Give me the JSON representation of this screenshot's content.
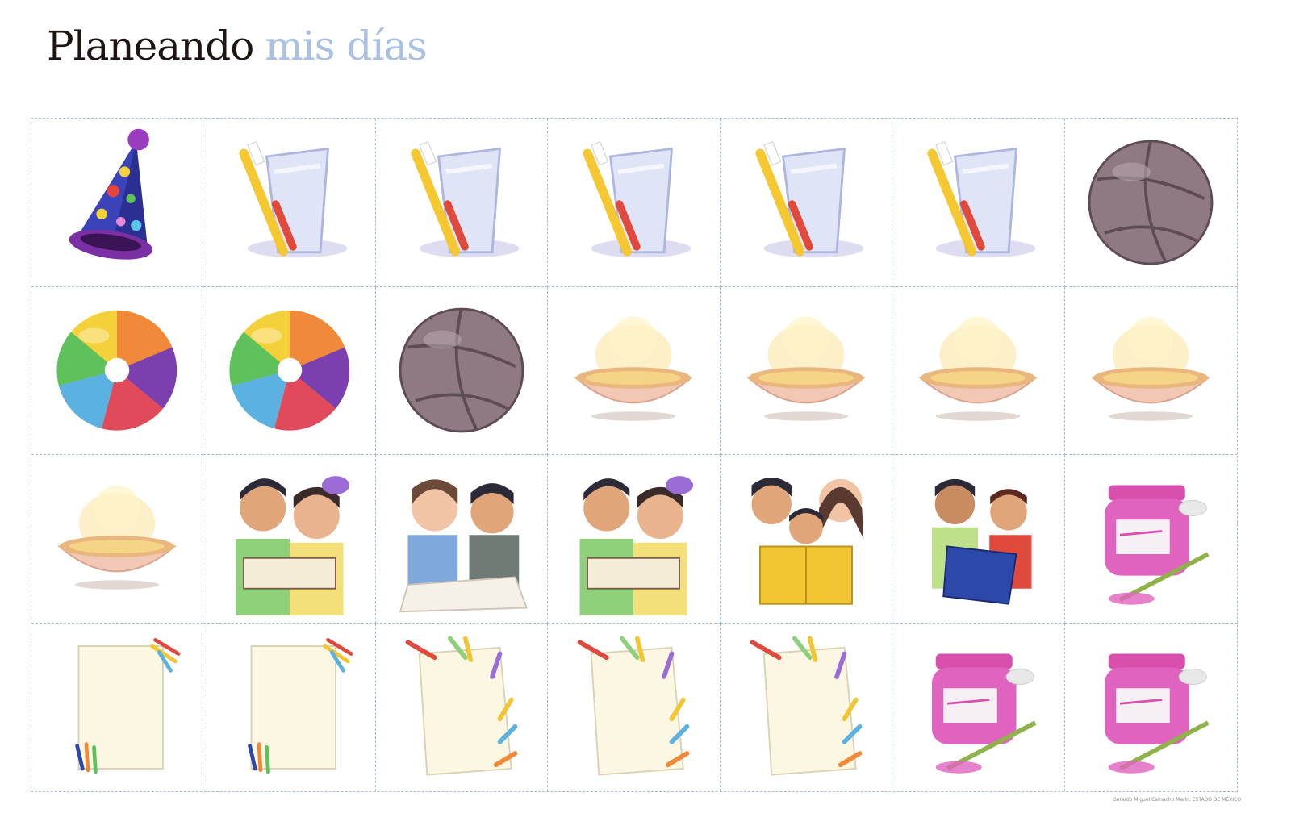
{
  "title": {
    "part1": "Planeando",
    "part2": "mis días"
  },
  "credit": "Gerardo Miguel Camacho Marín, ESTADO DE MÉXICO",
  "cards": [
    "party-hat",
    "toothbrush-glass",
    "toothbrush-glass",
    "toothbrush-glass",
    "toothbrush-glass",
    "toothbrush-glass",
    "volleyball",
    "beach-ball",
    "beach-ball",
    "volleyball",
    "soup-bowl",
    "soup-bowl",
    "soup-bowl",
    "soup-bowl",
    "soup-bowl",
    "children-reading-book",
    "children-doing-homework",
    "children-reading-book",
    "family-reading-book",
    "boys-reading-book",
    "paint-jar",
    "paper-crayons",
    "paper-crayons",
    "paper-crayons-tilted",
    "paper-crayons-tilted",
    "paper-crayons-tilted",
    "paint-jar",
    "paint-jar"
  ]
}
